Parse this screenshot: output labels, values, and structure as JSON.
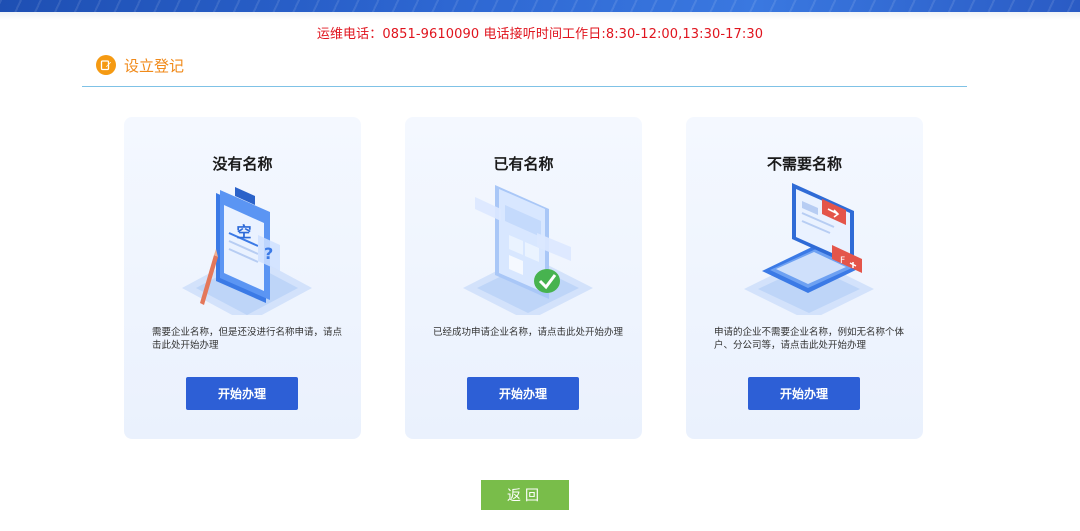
{
  "hotline": "运维电话：0851-9610090 电话接听时间工作日:8:30-12:00,13:30-17:30",
  "section": {
    "title": "设立登记",
    "icon": "edit-icon"
  },
  "cards": [
    {
      "title": "没有名称",
      "desc": "需要企业名称，但是还没进行名称申请，请点击此处开始办理",
      "button": "开始办理",
      "illus_glyph": "空",
      "illus_icon": "blank-document-icon"
    },
    {
      "title": "已有名称",
      "desc": "已经成功申请企业名称，请点击此处开始办理",
      "button": "开始办理",
      "illus_icon": "document-checkmark-icon"
    },
    {
      "title": "不需要名称",
      "desc": "申请的企业不需要企业名称，例如无名称个体户、分公司等，请点击此处开始办理",
      "button": "开始办理",
      "illus_icon": "laptop-icon"
    }
  ],
  "back_button": "返回",
  "colors": {
    "hotline": "#e0141e",
    "section": "#f08a1a",
    "primary": "#2d5fd6",
    "back": "#79bd4a",
    "rule": "#7fc2e6"
  }
}
